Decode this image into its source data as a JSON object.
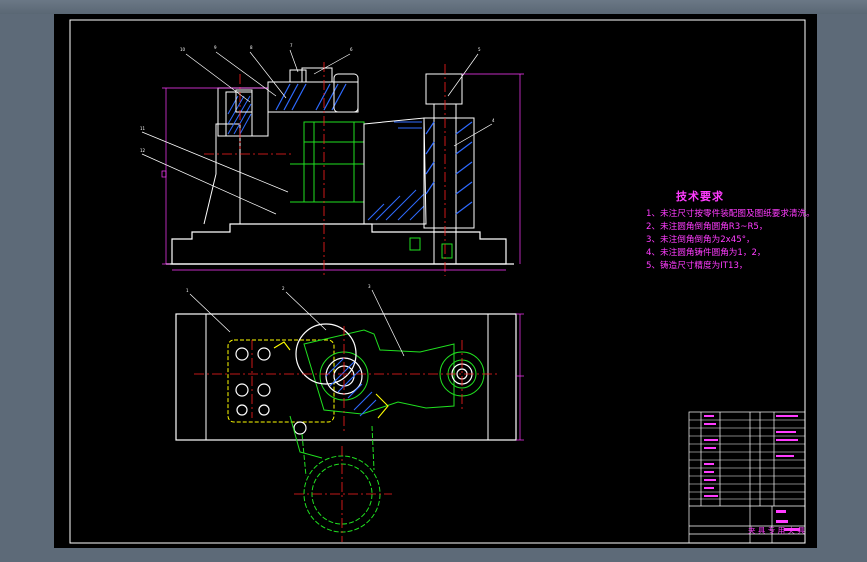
{
  "drawing": {
    "tech_requirements_title": "技术要求",
    "notes": [
      "1、未注尺寸按零件装配图及图纸要求清洗。",
      "2、未注圆角倒角圆角R3~R5，",
      "3、未注倒角倒角为2x45°，",
      "4、未注圆角铸件圆角为1，2，",
      "5、铸造尺寸精度为IT13，"
    ],
    "title_block_name": "夹 具 专 用 夹 具",
    "callouts_top": [
      "10",
      "9",
      "8",
      "7",
      "6",
      "5",
      "4",
      "11",
      "12"
    ],
    "callouts_plan": [
      "1",
      "2",
      "3"
    ]
  },
  "colors": {
    "background": "#000000",
    "border": "#ffffff",
    "outline": "#ffffff",
    "dimension": "#ff3cff",
    "centerline": "#ff2020",
    "hatch_blue": "#2f6bff",
    "part_green": "#20e020",
    "hidden_yellow": "#ffff00",
    "title_frame": "#ffffff"
  }
}
